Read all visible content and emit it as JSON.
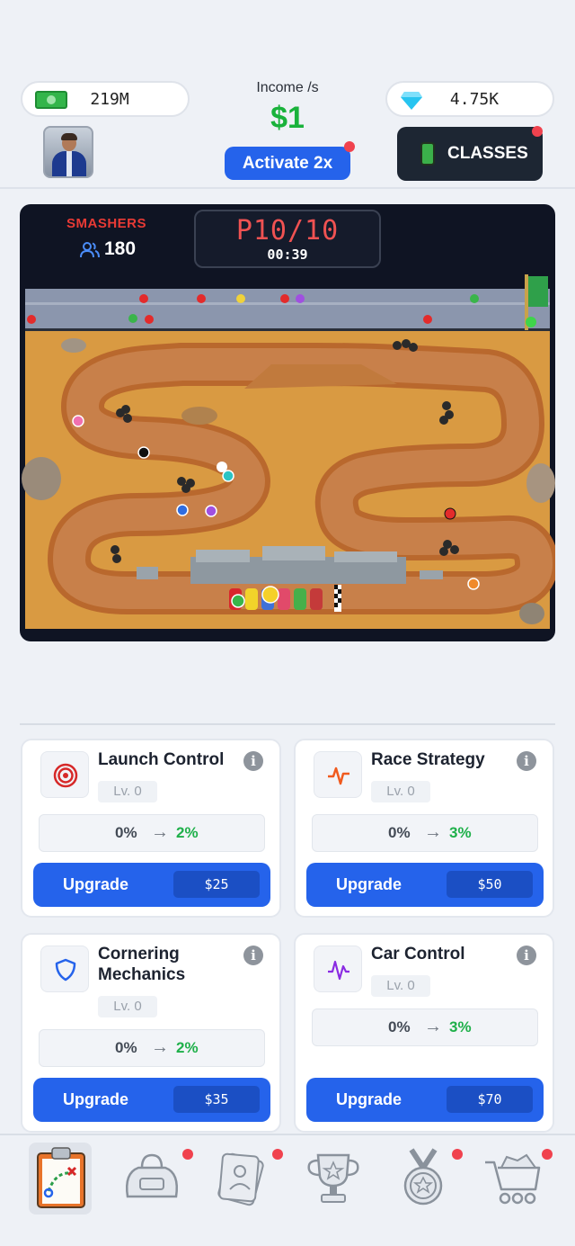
{
  "header": {
    "cash": "219M",
    "gems": "4.75K",
    "income_label": "Income /s",
    "income_value": "$1",
    "activate_label": "Activate 2x",
    "classes_label": "CLASSES"
  },
  "race": {
    "team_name": "SMASHERS",
    "members": "180",
    "position": "P10/10",
    "timer": "00:39"
  },
  "upgrades": [
    {
      "title": "Launch Control",
      "level": "Lv. 0",
      "from": "0%",
      "to": "2%",
      "button": "Upgrade",
      "price": "$25",
      "icon": "target-icon",
      "icon_color": "#d62828"
    },
    {
      "title": "Race Strategy",
      "level": "Lv. 0",
      "from": "0%",
      "to": "3%",
      "button": "Upgrade",
      "price": "$50",
      "icon": "pulse-icon",
      "icon_color": "#f05a1e"
    },
    {
      "title": "Cornering Mechanics",
      "level": "Lv. 0",
      "from": "0%",
      "to": "2%",
      "button": "Upgrade",
      "price": "$35",
      "icon": "shield-icon",
      "icon_color": "#2563eb"
    },
    {
      "title": "Car Control",
      "level": "Lv. 0",
      "from": "0%",
      "to": "3%",
      "button": "Upgrade",
      "price": "$70",
      "icon": "wave-icon",
      "icon_color": "#8a2be2"
    }
  ],
  "nav": [
    {
      "icon": "clipboard-strategy-icon",
      "selected": true
    },
    {
      "icon": "bag-icon"
    },
    {
      "icon": "cards-icon"
    },
    {
      "icon": "trophy-icon"
    },
    {
      "icon": "medal-icon"
    },
    {
      "icon": "cart-icon"
    }
  ],
  "colors": {
    "accent": "#2563eb",
    "income": "#19b23b",
    "alert": "#f0424e",
    "team": "#e83a35"
  }
}
